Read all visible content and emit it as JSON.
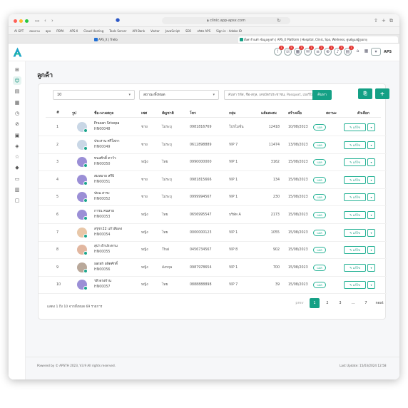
{
  "browser": {
    "url": "clinic.app-apsx.com",
    "bookmarks": [
      "AI GPT",
      "สอบถาม",
      "apx",
      "PDPA",
      "APS-X",
      "Cloud Hosting",
      "Tools Server",
      "API Bank",
      "Vector",
      "JavaScript",
      "SEO",
      "บริษัท APS",
      "Sign in - Adobe ID"
    ],
    "tabs": [
      {
        "title": "APS_X | Trello"
      },
      {
        "title": "ตั้งค่าร้านค้า ข้อมูลลูกค้า | APS_X Platform | Hospital, Clinic, Spa, Wellness, ศูนย์ดูแลผู้สูงอายุ"
      }
    ]
  },
  "header": {
    "user": "APS",
    "notification_badges": [
      "1",
      "5",
      "3",
      "1",
      "2",
      "1",
      "3",
      "1",
      "4",
      ""
    ]
  },
  "page": {
    "title": "ลูกค้า"
  },
  "filters": {
    "page_size": "10",
    "status": "สถานะทั้งหมด",
    "search_placeholder": "ค้นหา รหัส, ชื่อ-สกุล, เลขบัตรประชาชน, Passport, เบอร์โทร, E-mail",
    "search_button": "ค้นหา",
    "export_icon": "export-icon",
    "add_icon": "plus-icon",
    "add_label": "+"
  },
  "table": {
    "columns": [
      "#",
      "รูป",
      "ชื่อ-นามสกุล",
      "เพศ",
      "สัญชาติ",
      "โทร",
      "กลุ่ม",
      "แต้มสะสม",
      "สร้างเมื่อ",
      "สถานะ",
      "ตัวเลือก"
    ],
    "rows": [
      {
        "no": "1",
        "name": "Prasan Srisopa",
        "code": "HN00048",
        "gender": "ชาย",
        "nationality": "ไม่ระบุ",
        "phone": "0981816769",
        "group": "โปรโมชั่น",
        "points": "12418",
        "created": "10/08/2023",
        "status": "แอค",
        "edit": "แก้ไข",
        "avatar_color": "#c9d7e6"
      },
      {
        "no": "2",
        "name": "ประสาน ศรีโสภา",
        "code": "HN00049",
        "gender": "ชาย",
        "nationality": "ไม่ระบุ",
        "phone": "0612898889",
        "group": "VIP 7",
        "points": "11474",
        "created": "13/08/2023",
        "status": "แอค",
        "edit": "แก้ไข",
        "avatar_color": "#c9d7e6"
      },
      {
        "no": "3",
        "name": "ทนงศักดิ์ ดาวัว",
        "code": "HN00050",
        "gender": "หญิง",
        "nationality": "ไทย",
        "phone": "0990000000",
        "group": "VIP 1",
        "points": "3162",
        "created": "15/08/2023",
        "status": "แอค",
        "edit": "แก้ไข",
        "avatar_color": "#9b8fd6"
      },
      {
        "no": "4",
        "name": "สมหมาย สรีบิ",
        "code": "HN00051",
        "gender": "ชาย",
        "nationality": "ไม่ระบุ",
        "phone": "0981815666",
        "group": "VIP 1",
        "points": "134",
        "created": "15/08/2023",
        "status": "แอค",
        "edit": "แก้ไข",
        "avatar_color": "#9b8fd6"
      },
      {
        "no": "5",
        "name": "ปพน สาระ",
        "code": "HN00052",
        "gender": "ชาย",
        "nationality": "ไม่ระบุ",
        "phone": "0999994567",
        "group": "VIP 1",
        "points": "230",
        "created": "15/08/2023",
        "status": "แอค",
        "edit": "แก้ไข",
        "avatar_color": "#9b8fd6"
      },
      {
        "no": "6",
        "name": "การน คนสาย",
        "code": "HN00053",
        "gender": "หญิง",
        "nationality": "ไทย",
        "phone": "0656995547",
        "group": "บริษัท A",
        "points": "2173",
        "created": "15/08/2023",
        "status": "แอค",
        "edit": "แก้ไข",
        "avatar_color": "#9b8fd6"
      },
      {
        "no": "7",
        "name": "สรุชา22 แก้วสีแดง",
        "code": "HN00054",
        "gender": "หญิง",
        "nationality": "ไทย",
        "phone": "0000000123",
        "group": "VIP 1",
        "points": "1055",
        "created": "15/08/2023",
        "status": "แอค",
        "edit": "แก้ไข",
        "avatar_color": "#e8c7a8"
      },
      {
        "no": "8",
        "name": "สุปา ผ้าประทาม",
        "code": "HN00055",
        "gender": "หญิง",
        "nationality": "Thai",
        "phone": "0456734567",
        "group": "VIP 8",
        "points": "902",
        "created": "15/08/2023",
        "status": "แอค",
        "edit": "แก้ไข",
        "avatar_color": "#e2b7a0"
      },
      {
        "no": "9",
        "name": "sarah ผลิตศักดิ์",
        "code": "HN00056",
        "gender": "หญิง",
        "nationality": "อังกฤษ",
        "phone": "0987978654",
        "group": "VIP 1",
        "points": "700",
        "created": "15/08/2023",
        "status": "แอค",
        "edit": "แก้ไข",
        "avatar_color": "#b9a89a"
      },
      {
        "no": "10",
        "name": "รพี ตรงจ้าน",
        "code": "HN00057",
        "gender": "หญิง",
        "nationality": "ไทย",
        "phone": "0888888898",
        "group": "VIP 7",
        "points": "39",
        "created": "15/08/2023",
        "status": "แอค",
        "edit": "แก้ไข",
        "avatar_color": "#9b8fd6"
      }
    ]
  },
  "pagination": {
    "summary": "แสดง 1 ถึง 10 จากทั้งหมด 69 รายการ",
    "prev": "prev",
    "pages": [
      "1",
      "2",
      "3",
      "...",
      "7"
    ],
    "current": "1",
    "next": "next"
  },
  "footer": {
    "left": "Powered by © APSTH 2023, V3.9 All rights reserved.",
    "right": "Last Update: 15/03/2024 12:58"
  },
  "colors": {
    "accent": "#14a085",
    "badge": "#e53935"
  }
}
